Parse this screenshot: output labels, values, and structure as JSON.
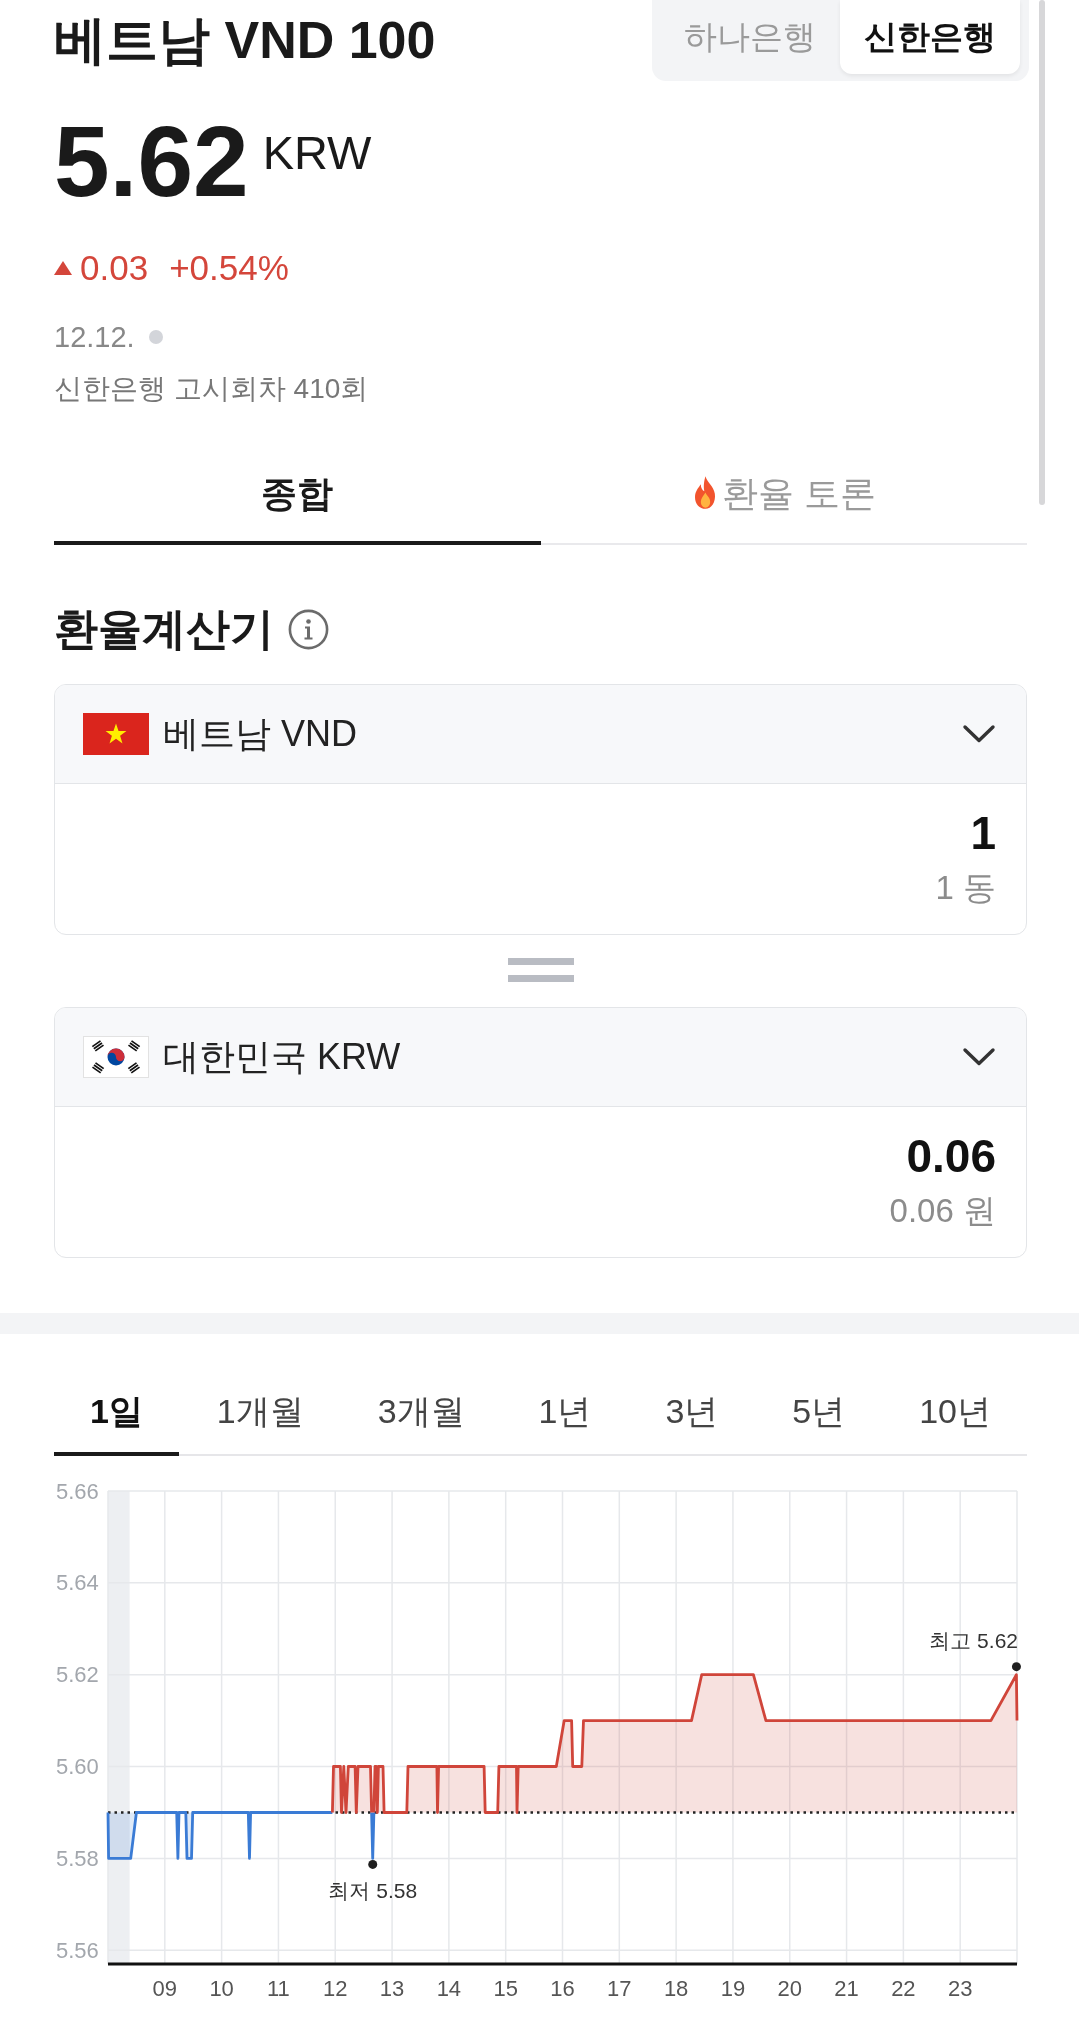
{
  "header": {
    "title": "베트남 VND 100",
    "banks": [
      {
        "label": "하나은행",
        "selected": false
      },
      {
        "label": "신한은행",
        "selected": true
      }
    ]
  },
  "quote": {
    "price": "5.62",
    "unit": "KRW",
    "rising": true,
    "change": "0.03",
    "change_percent": "+0.54%",
    "date": "12.12.",
    "live": false,
    "notice": "신한은행 고시회차 410회"
  },
  "tabs": [
    {
      "kind": "plain",
      "label": "종합",
      "selected": true
    },
    {
      "kind": "hot",
      "label": "환율 토론",
      "selected": false
    }
  ],
  "calculator": {
    "title": "환율계산기",
    "currencies": [
      {
        "kind": "vn",
        "name": "베트남 VND",
        "amount": "1",
        "amount_text": "1 동"
      },
      {
        "kind": "kr",
        "name": "대한민국 KRW",
        "amount": "0.06",
        "amount_text": "0.06 원"
      }
    ]
  },
  "chart": {
    "periods": [
      {
        "label": "1일",
        "selected": true
      },
      {
        "label": "1개월",
        "selected": false
      },
      {
        "label": "3개월",
        "selected": false
      },
      {
        "label": "1년",
        "selected": false
      },
      {
        "label": "3년",
        "selected": false
      },
      {
        "label": "5년",
        "selected": false
      },
      {
        "label": "10년",
        "selected": false
      }
    ],
    "chart_data": {
      "type": "area",
      "grid": true,
      "x": [
        8,
        8.01,
        8.4,
        8.5,
        9.21,
        9.23,
        9.25,
        9.37,
        9.39,
        9.47,
        9.49,
        10.47,
        10.49,
        10.51,
        11.95,
        11.97,
        12.09,
        12.11,
        12.15,
        12.19,
        12.23,
        12.35,
        12.37,
        12.4,
        12.62,
        12.64,
        12.66,
        12.68,
        12.7,
        12.72,
        12.74,
        12.76,
        12.84,
        12.86,
        13.26,
        13.28,
        13.79,
        13.8,
        13.82,
        14.62,
        14.64,
        14.86,
        14.88,
        15.19,
        15.2,
        15.22,
        15.89,
        16.03,
        16.16,
        16.18,
        16.34,
        16.37,
        18.27,
        18.45,
        19.36,
        19.58,
        23.54,
        23.99,
        24
      ],
      "series": [
        {
          "color": "#3a7bd5",
          "values": [
            5.59,
            5.58,
            5.58,
            5.59,
            5.59,
            5.58,
            5.59,
            5.59,
            5.58,
            5.58,
            5.59,
            5.59,
            5.58,
            5.59,
            5.59,
            null,
            null,
            null,
            null,
            null,
            null,
            null,
            null,
            null,
            null,
            5.59,
            5.58,
            5.59,
            null,
            null,
            null,
            null,
            null,
            null,
            null,
            null,
            null,
            null,
            null,
            null,
            null,
            null,
            null,
            null,
            null,
            null,
            null,
            null,
            null,
            null,
            null,
            null,
            null,
            null,
            null,
            null,
            null,
            null,
            null
          ]
        },
        {
          "color": "#d0453a",
          "values": [
            null,
            null,
            null,
            null,
            null,
            null,
            null,
            null,
            null,
            null,
            null,
            null,
            null,
            null,
            5.59,
            5.6,
            5.6,
            5.59,
            5.6,
            5.59,
            5.6,
            5.6,
            5.59,
            5.6,
            5.6,
            5.59,
            null,
            5.59,
            5.6,
            5.6,
            5.59,
            5.6,
            5.6,
            5.59,
            5.59,
            5.6,
            5.6,
            5.59,
            5.6,
            5.6,
            5.59,
            5.59,
            5.6,
            5.6,
            5.59,
            5.6,
            5.6,
            5.61,
            5.61,
            5.6,
            5.6,
            5.61,
            5.61,
            5.62,
            5.62,
            5.61,
            5.61,
            5.62,
            5.61
          ]
        }
      ],
      "xlim": [
        8,
        24
      ],
      "ylim": [
        5.557,
        5.66
      ],
      "xticks": [
        {
          "value": 9,
          "label": "09"
        },
        {
          "value": 10,
          "label": "10"
        },
        {
          "value": 11,
          "label": "11"
        },
        {
          "value": 12,
          "label": "12"
        },
        {
          "value": 13,
          "label": "13"
        },
        {
          "value": 14,
          "label": "14"
        },
        {
          "value": 15,
          "label": "15"
        },
        {
          "value": 16,
          "label": "16"
        },
        {
          "value": 17,
          "label": "17"
        },
        {
          "value": 18,
          "label": "18"
        },
        {
          "value": 19,
          "label": "19"
        },
        {
          "value": 20,
          "label": "20"
        },
        {
          "value": 21,
          "label": "21"
        },
        {
          "value": 22,
          "label": "22"
        },
        {
          "value": 23,
          "label": "23"
        }
      ],
      "yticks": [
        {
          "value": 5.56,
          "label": "5.56"
        },
        {
          "value": 5.58,
          "label": "5.58"
        },
        {
          "value": 5.6,
          "label": "5.60"
        },
        {
          "value": 5.62,
          "label": "5.62"
        },
        {
          "value": 5.64,
          "label": "5.64"
        },
        {
          "value": 5.66,
          "label": "5.66"
        }
      ],
      "ref_lines": [
        {
          "axis": "y",
          "value": 5.59
        }
      ],
      "bands": [
        {
          "axis": "x",
          "from": 8,
          "to": 8.38
        }
      ],
      "annotations": [
        {
          "text": "최고 5.62",
          "x": 23.99,
          "y": 5.62
        },
        {
          "text": "최저 5.58",
          "x": 12.66,
          "y": 5.58
        }
      ]
    }
  }
}
